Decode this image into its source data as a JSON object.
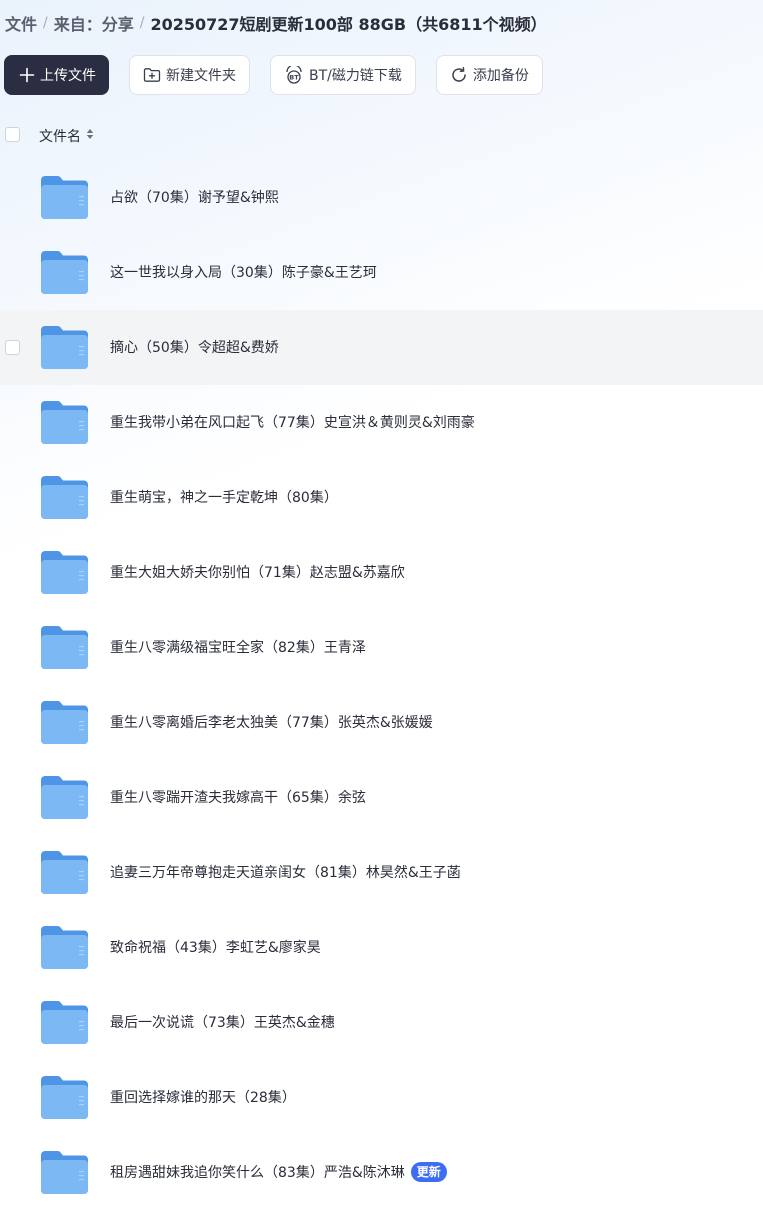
{
  "breadcrumb": {
    "root": "文件",
    "source": "来自：分享",
    "current": "20250727短剧更新100部 88GB（共6811个视频）",
    "separator": "/"
  },
  "toolbar": {
    "upload_label": "上传文件",
    "new_folder_label": "新建文件夹",
    "bt_label": "BT/磁力链下载",
    "backup_label": "添加备份"
  },
  "list": {
    "column_name": "文件名",
    "rows": [
      {
        "name": "占欲（70集）谢予望&钟熙",
        "badge": ""
      },
      {
        "name": "这一世我以身入局（30集）陈子豪&王艺珂",
        "badge": ""
      },
      {
        "name": "摘心（50集）令超超&费娇",
        "badge": ""
      },
      {
        "name": "重生我带小弟在风口起飞（77集）史宣洪＆黄则灵&刘雨豪",
        "badge": ""
      },
      {
        "name": "重生萌宝，神之一手定乾坤（80集）",
        "badge": ""
      },
      {
        "name": "重生大姐大娇夫你别怕（71集）赵志盟&苏嘉欣",
        "badge": ""
      },
      {
        "name": "重生八零满级福宝旺全家（82集）王青泽",
        "badge": ""
      },
      {
        "name": "重生八零离婚后李老太独美（77集）张英杰&张媛媛",
        "badge": ""
      },
      {
        "name": "重生八零踹开渣夫我嫁高干（65集）余弦",
        "badge": ""
      },
      {
        "name": "追妻三万年帝尊抱走天道亲闺女（81集）林昊然&王子菡",
        "badge": ""
      },
      {
        "name": "致命祝福（43集）李虹艺&廖家昊",
        "badge": ""
      },
      {
        "name": "最后一次说谎（73集）王英杰&金穗",
        "badge": ""
      },
      {
        "name": "重回选择嫁谁的那天（28集）",
        "badge": ""
      },
      {
        "name": "租房遇甜妹我追你笑什么（83集）严浩&陈沐琳",
        "badge": "更新"
      }
    ]
  },
  "colors": {
    "primary_button": "#2b2e43",
    "folder": "#6aaef2",
    "badge": "#3d6df2",
    "row_hover": "#f3f4f6"
  },
  "icons": {
    "upload": "plus-icon",
    "new_folder": "folder-plus-icon",
    "bt": "bt-icon",
    "backup": "refresh-icon",
    "sort": "sort-icon",
    "folder": "folder-icon"
  }
}
